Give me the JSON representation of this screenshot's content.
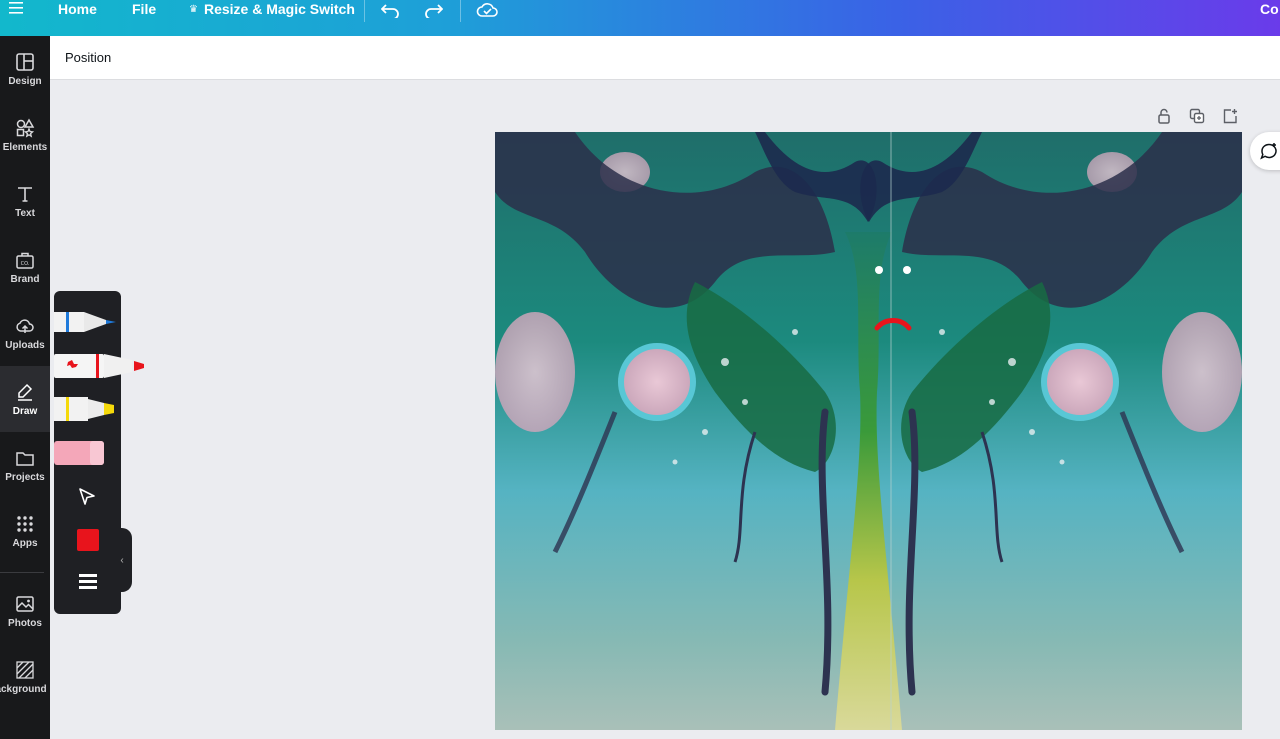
{
  "topbar": {
    "menu_icon": "hamburger-icon",
    "home": "Home",
    "file": "File",
    "resize": "Resize & Magic Switch",
    "copy_partial": "Co"
  },
  "sidebar": {
    "items": [
      {
        "label": "Design",
        "icon": "layout-icon"
      },
      {
        "label": "Elements",
        "icon": "shapes-icon"
      },
      {
        "label": "Text",
        "icon": "text-icon"
      },
      {
        "label": "Brand",
        "icon": "brand-kit-icon"
      },
      {
        "label": "Uploads",
        "icon": "cloud-upload-icon"
      },
      {
        "label": "Draw",
        "icon": "pen-icon"
      },
      {
        "label": "Projects",
        "icon": "folder-icon"
      },
      {
        "label": "Apps",
        "icon": "grid-icon"
      },
      {
        "label": "Photos",
        "icon": "image-icon"
      },
      {
        "label": "ackground",
        "icon": "background-pattern-icon"
      }
    ],
    "active": "Draw"
  },
  "context_toolbar": {
    "position_label": "Position"
  },
  "draw_panel": {
    "tools": [
      "pen",
      "marker",
      "highlighter",
      "eraser",
      "select"
    ],
    "selected_tool": "marker",
    "current_color": "#e8141c"
  },
  "colors": {
    "accent_blue": "#3a62e6",
    "accent_teal": "#12b8cc",
    "sidebar_bg": "#18191b",
    "pen_red": "#e8141c"
  }
}
